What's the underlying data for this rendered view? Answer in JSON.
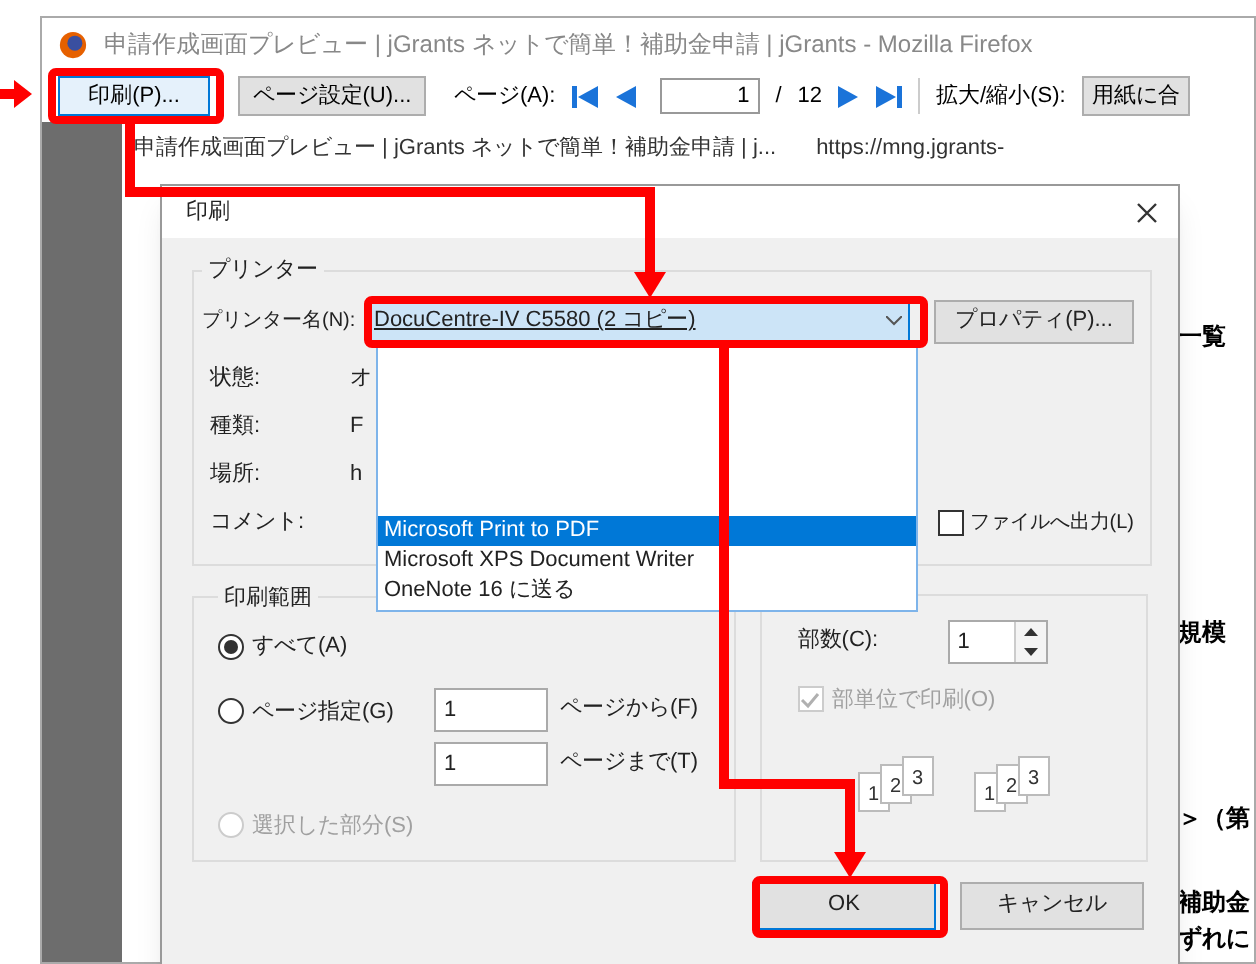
{
  "window": {
    "title": "申請作成画面プレビュー | jGrants ネットで簡単！補助金申請 | jGrants - Mozilla Firefox"
  },
  "toolbar": {
    "print_button": "印刷(P)...",
    "page_setup_button": "ページ設定(U)...",
    "page_label": "ページ(A):",
    "page_input": "1",
    "page_total": "/",
    "page_count": "12",
    "zoom_label": "拡大/縮小(S):",
    "zoom_select": "用紙に合"
  },
  "preview": {
    "header_title": "申請作成画面プレビュー | jGrants ネットで簡単！補助金申請 | j...",
    "header_url": "https://mng.jgrants-",
    "fragments": [
      "一覧",
      "規模",
      "＞（第",
      "補助金",
      "ずれに"
    ]
  },
  "dialog": {
    "title": "印刷",
    "printer_group": {
      "label": "プリンター",
      "name_label": "プリンター名(N):",
      "selected_printer": "DocuCentre-IV C5580 (2 コピー)",
      "properties_button": "プロパティ(P)...",
      "info": [
        {
          "label": "状態:",
          "value": "オ"
        },
        {
          "label": "種類:",
          "value": "F"
        },
        {
          "label": "場所:",
          "value": "h"
        },
        {
          "label": "コメント:"
        }
      ],
      "print_to_file": {
        "label": "ファイルへ出力(L)",
        "checked": false
      }
    },
    "printer_list": [
      {
        "label": "Microsoft Print to PDF",
        "selected": true
      },
      {
        "label": "Microsoft XPS Document Writer",
        "selected": false
      },
      {
        "label": "OneNote 16 に送る",
        "selected": false
      }
    ],
    "range_group": {
      "label": "印刷範囲",
      "options": [
        {
          "label": "すべて(A)",
          "selected": true,
          "disabled": false
        },
        {
          "label": "ページ指定(G)",
          "selected": false,
          "disabled": false
        },
        {
          "label": "選択した部分(S)",
          "selected": false,
          "disabled": true
        }
      ],
      "from_value": "1",
      "from_label": "ページから(F)",
      "to_value": "1",
      "to_label": "ページまで(T)"
    },
    "copies_group": {
      "copies_label": "部数(C):",
      "copies_value": "1",
      "collate": {
        "label": "部単位で印刷(O)",
        "checked": true,
        "disabled": true
      },
      "collate_icons": [
        [
          "1",
          "2",
          "3"
        ],
        [
          "1",
          "2",
          "3"
        ]
      ]
    },
    "buttons": {
      "ok": "OK",
      "cancel": "キャンセル"
    }
  }
}
